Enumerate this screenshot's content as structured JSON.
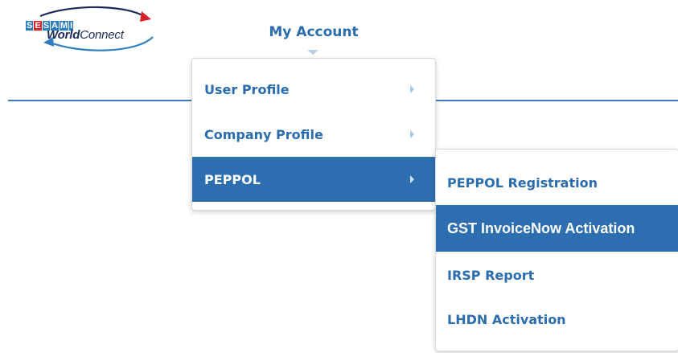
{
  "logo": {
    "badge_letters": [
      "S",
      "E",
      "S",
      "A",
      "M",
      "I"
    ],
    "word_bold": "World",
    "word_regular": "Connect"
  },
  "nav": {
    "title": "My Account"
  },
  "menu_level1": {
    "items": [
      {
        "label": "User Profile",
        "active": false
      },
      {
        "label": "Company Profile",
        "active": false
      },
      {
        "label": "PEPPOL",
        "active": true
      }
    ]
  },
  "menu_level2": {
    "items": [
      {
        "label": "PEPPOL Registration",
        "active": false
      },
      {
        "label": "GST InvoiceNow Activation",
        "active": true
      },
      {
        "label": "IRSP Report",
        "active": false
      },
      {
        "label": "LHDN Activation",
        "active": false
      }
    ]
  },
  "colors": {
    "accent": "#2a6cae",
    "active_bg": "#2d6eb0",
    "rule": "#3f7cbd",
    "logo_red": "#d8232a",
    "logo_blue": "#2d7fc1",
    "logo_navy": "#1c2a56"
  }
}
